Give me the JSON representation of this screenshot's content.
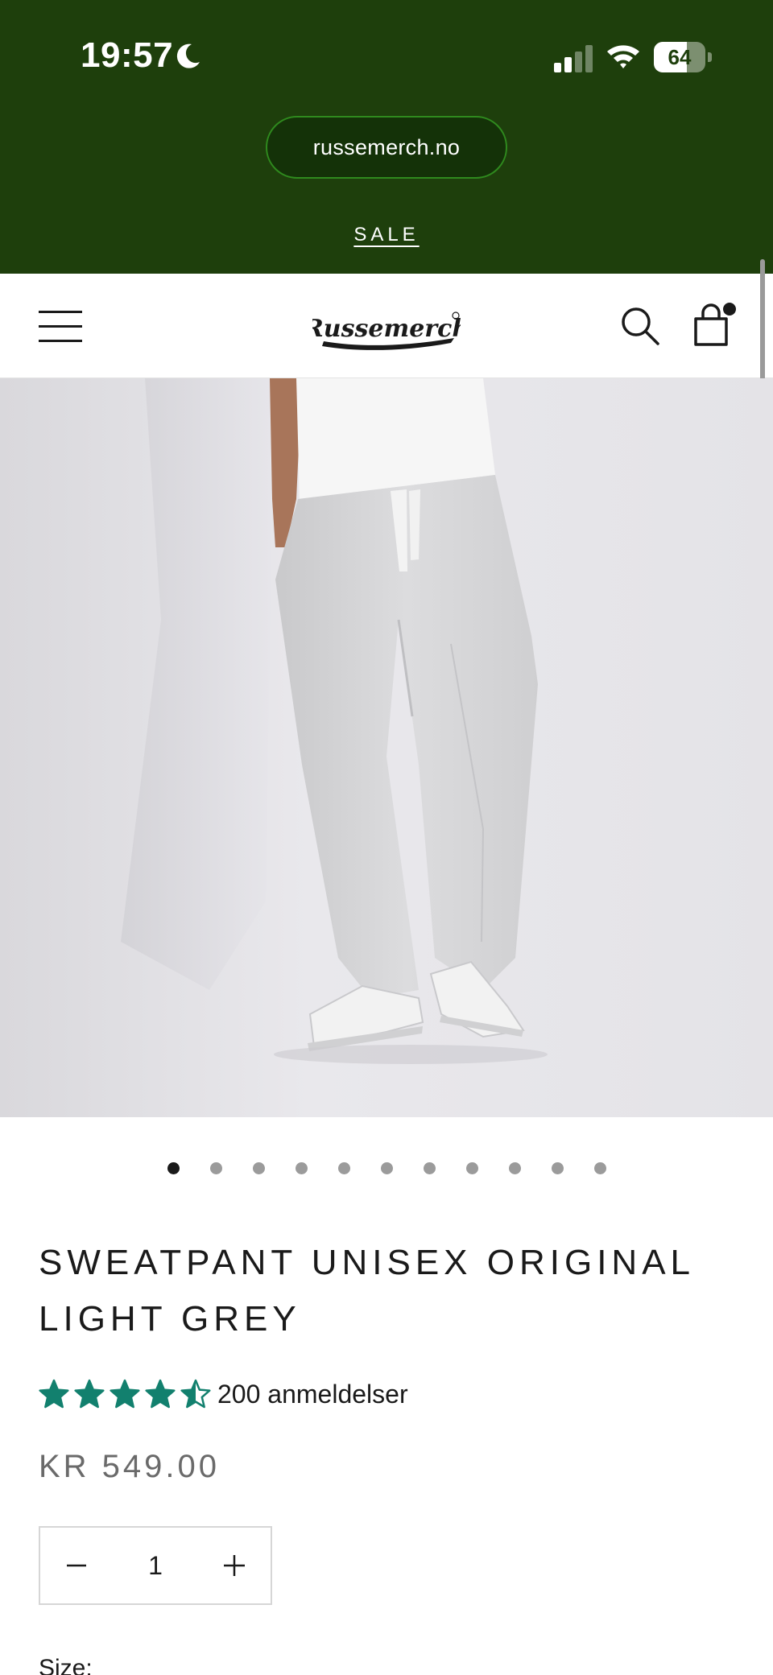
{
  "status_bar": {
    "time": "19:57",
    "battery_percent": "64",
    "battery_level": 0.64
  },
  "browser": {
    "url": "russemerch.no"
  },
  "announcement": {
    "link_label": "SALE"
  },
  "header": {
    "logo_text": "Russemerch",
    "cart_has_items": true
  },
  "product": {
    "title": "SWEATPANT UNISEX ORIGINAL LIGHT GREY",
    "rating": 4.5,
    "review_label": "200 anmeldelser",
    "price": "KR 549.00",
    "quantity": "1",
    "size_label": "Size:"
  },
  "gallery": {
    "image_count": 11,
    "active_index": 0
  },
  "colors": {
    "top_bar_bg": "#1e3f0c",
    "url_pill_border": "#2f8a1e",
    "star_color": "#12806e",
    "price_color": "#6a6a6a"
  }
}
